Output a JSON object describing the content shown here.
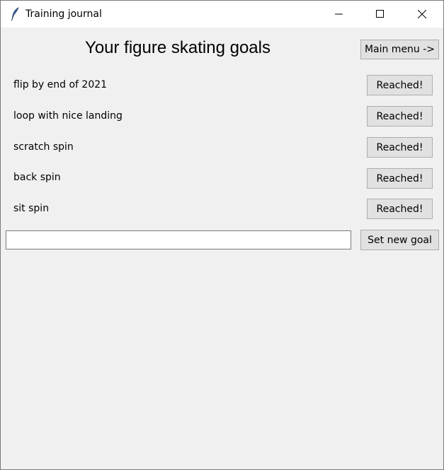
{
  "window": {
    "title": "Training journal",
    "icon": "feather-icon"
  },
  "header": {
    "title": "Your figure skating goals",
    "main_menu_label": "Main menu ->"
  },
  "goals": [
    {
      "label": "flip by end of 2021",
      "button": "Reached!"
    },
    {
      "label": "loop with nice landing",
      "button": "Reached!"
    },
    {
      "label": "scratch spin",
      "button": "Reached!"
    },
    {
      "label": "back spin",
      "button": "Reached!"
    },
    {
      "label": "sit spin",
      "button": "Reached!"
    }
  ],
  "new_goal": {
    "input_value": "",
    "button_label": "Set new goal"
  },
  "colors": {
    "window_bg": "#f0f0f0",
    "button_bg": "#e1e1e1",
    "button_border": "#adadad"
  }
}
